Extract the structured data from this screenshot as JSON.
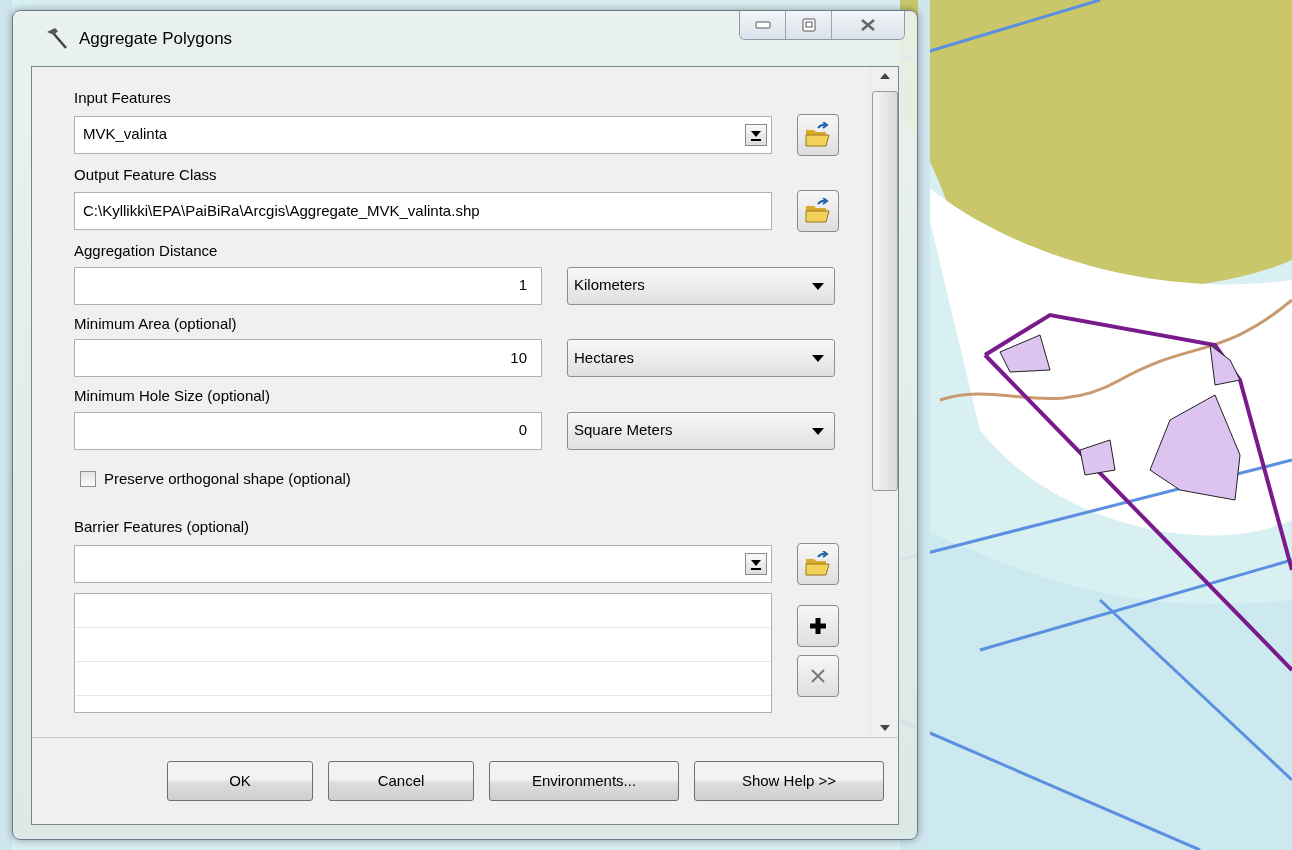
{
  "window": {
    "title": "Aggregate Polygons"
  },
  "parameters": [
    {
      "kind": "combo",
      "label": "Input Features",
      "value": "MVK_valinta"
    },
    {
      "kind": "path",
      "label": "Output Feature Class",
      "value": "C:\\Kyllikki\\EPA\\PaiBiRa\\Arcgis\\Aggregate_MVK_valinta.shp"
    },
    {
      "kind": "number_unit",
      "label": "Aggregation Distance",
      "value": "1",
      "unit": "Kilometers"
    },
    {
      "kind": "number_unit",
      "label": "Minimum Area (optional)",
      "value": "10",
      "unit": "Hectares"
    },
    {
      "kind": "number_unit",
      "label": "Minimum Hole Size (optional)",
      "value": "0",
      "unit": "Square Meters"
    },
    {
      "kind": "checkbox",
      "label": "Preserve orthogonal shape (optional)",
      "checked": false
    },
    {
      "kind": "combo",
      "label": "Barrier Features (optional)"
    },
    {
      "kind": "list"
    }
  ],
  "buttons": [
    "OK",
    "Cancel",
    "Environments...",
    "Show Help >>"
  ]
}
